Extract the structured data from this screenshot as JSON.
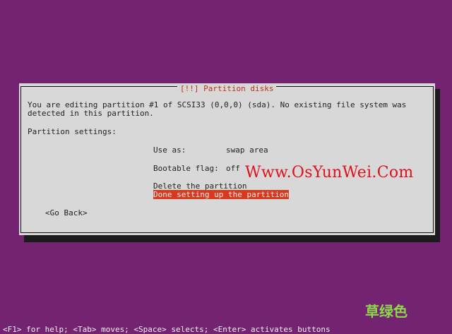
{
  "dialog": {
    "title": "[!!] Partition disks",
    "description_line1": "You are editing partition #1 of SCSI33 (0,0,0) (sda). No existing file system was",
    "description_line2": "detected in this partition.",
    "settings_heading": "Partition settings:",
    "use_as_label": "Use as:",
    "use_as_value": "swap area",
    "bootable_label": "Bootable flag:",
    "bootable_value": "off",
    "delete_option": "Delete the partition",
    "done_option": "Done setting up the partition",
    "back_button": "<Go Back>"
  },
  "watermark": {
    "text": "Www.OsYunWei.Com",
    "color": "#e0101c",
    "chinese_text": "草绿色",
    "chinese_color": "#8ed84b"
  },
  "statusbar": {
    "help_text": "<F1> for help; <Tab> moves; <Space> selects; <Enter> activates buttons"
  },
  "colors": {
    "background": "#742371",
    "dialog": "#d8d8d8",
    "selection": "#d73a1d",
    "title": "#c0301a"
  }
}
